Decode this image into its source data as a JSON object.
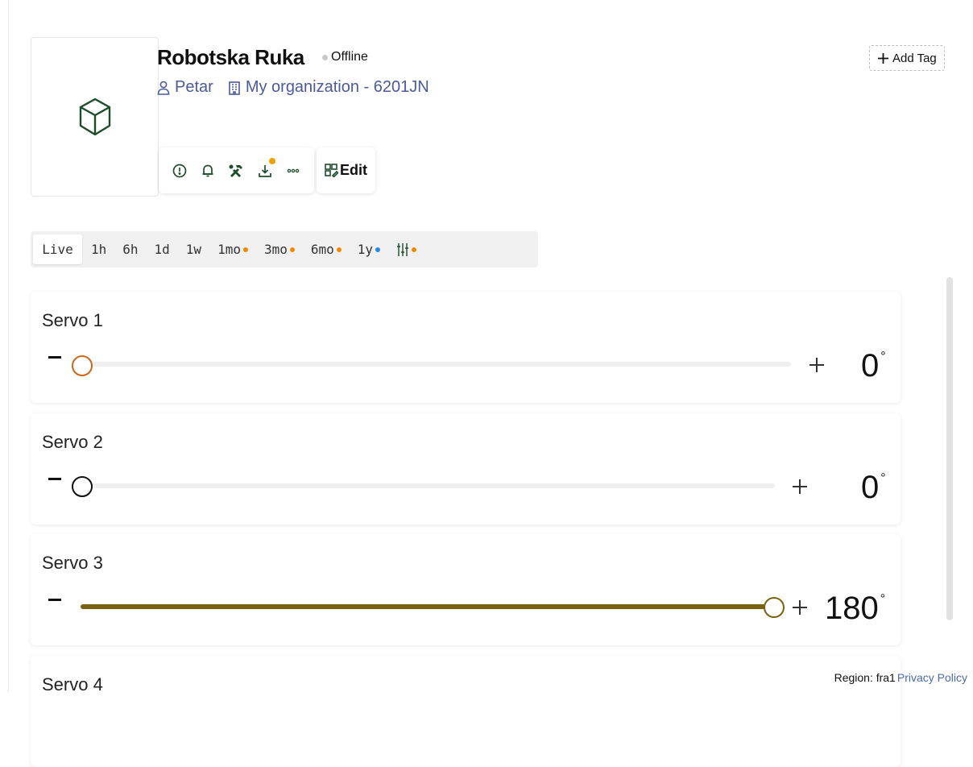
{
  "device": {
    "name": "Robotska Ruka",
    "status": "Offline",
    "owner": "Petar",
    "organization": "My organization - 6201JN",
    "icon": "cube-icon"
  },
  "header": {
    "add_tag_label": "Add Tag",
    "edit_label": "Edit"
  },
  "toolbar": {
    "icons": [
      "info-icon",
      "bell-icon",
      "tools-icon",
      "download-icon",
      "more-icon"
    ],
    "download_badge_color": "#f0a000"
  },
  "time_ranges": [
    {
      "label": "Live",
      "active": true
    },
    {
      "label": "1h"
    },
    {
      "label": "6h"
    },
    {
      "label": "1d"
    },
    {
      "label": "1w"
    },
    {
      "label": "1mo",
      "dot": "#f08a00"
    },
    {
      "label": "3mo",
      "dot": "#f08a00"
    },
    {
      "label": "6mo",
      "dot": "#f08a00"
    },
    {
      "label": "1y",
      "dot": "#2a8ae0"
    },
    {
      "label": "",
      "icon": "sliders-icon",
      "dot": "#f08a00"
    }
  ],
  "servos": [
    {
      "label": "Servo 1",
      "value": "0",
      "unit": "°",
      "level": 0,
      "accent": "#c8691d"
    },
    {
      "label": "Servo 2",
      "value": "0",
      "unit": "°",
      "level": 0,
      "accent": "#111111"
    },
    {
      "label": "Servo 3",
      "value": "180",
      "unit": "°",
      "level": 1,
      "accent": "#7a6210"
    },
    {
      "label": "Servo 4"
    }
  ],
  "footer": {
    "region": "Region: fra1",
    "privacy": "Privacy Policy"
  },
  "colors": {
    "accent_green": "#1e4d2b",
    "link_blue": "#4a5a9a"
  }
}
